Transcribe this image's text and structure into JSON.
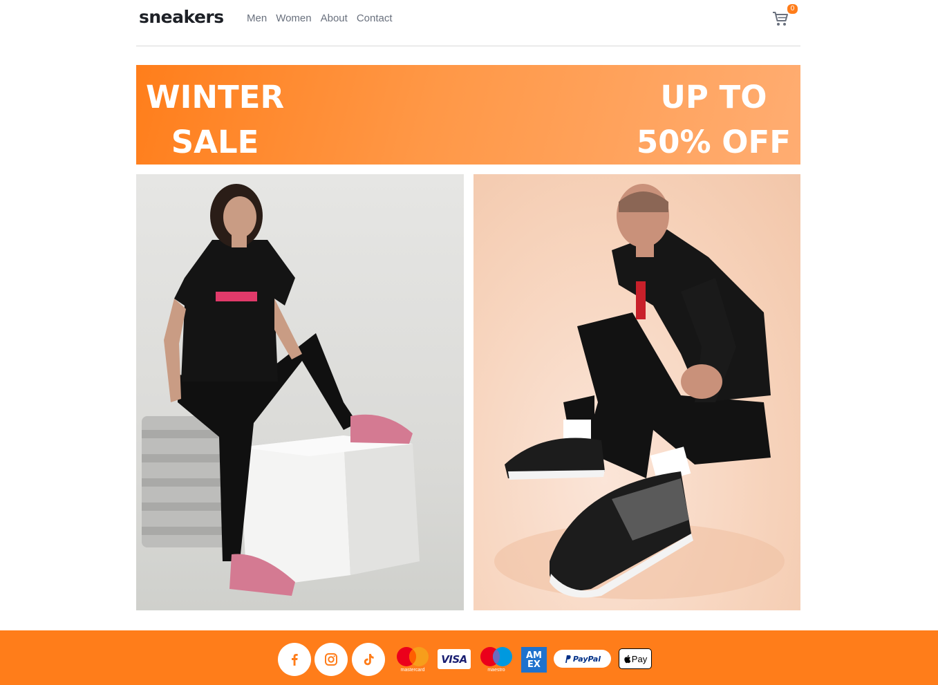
{
  "header": {
    "logo": "sneakers",
    "nav": [
      "Men",
      "Women",
      "About",
      "Contact"
    ],
    "cart_icon": "cart-icon",
    "cart_count": "0"
  },
  "banner": {
    "left_line1": "WINTER",
    "left_line2": "SALE",
    "right_line1": "UP TO",
    "right_line2": "50% OFF"
  },
  "photos": {
    "left": "woman-in-black-puma-outfit-photo",
    "right": "man-in-black-ferrari-tracksuit-photo"
  },
  "footer": {
    "social": [
      "facebook-icon",
      "instagram-icon",
      "tiktok-icon"
    ],
    "payments": {
      "mastercard": "mastercard",
      "maestro": "maestro",
      "visa": "VISA",
      "amex_line1": "AM",
      "amex_line2": "EX",
      "paypal": "PayPal",
      "applepay": "Pay"
    }
  },
  "colors": {
    "accent": "#ff7d1a",
    "text_dark": "#1d2026",
    "nav_text": "#69707d"
  }
}
